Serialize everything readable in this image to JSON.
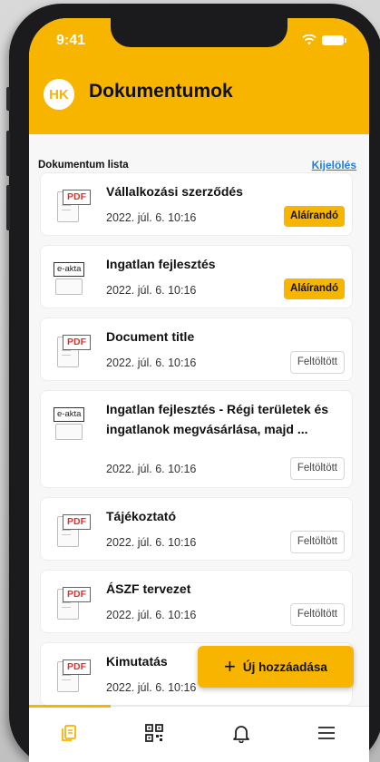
{
  "status_bar": {
    "time": "9:41"
  },
  "header": {
    "avatar_initials": "HK",
    "title": "Dokumentumok"
  },
  "list": {
    "title": "Dokumentum lista",
    "select_link": "Kijelölés"
  },
  "documents": [
    {
      "type": "PDF",
      "title": "Vállalkozási szerződés",
      "date": "2022. júl. 6. 10:16",
      "status": "Aláírandó"
    },
    {
      "type": "e-akta",
      "title": "Ingatlan fejlesztés",
      "date": "2022. júl. 6. 10:16",
      "status": "Aláírandó"
    },
    {
      "type": "PDF",
      "title": "Document title",
      "date": "2022. júl. 6. 10:16",
      "status": "Feltöltött"
    },
    {
      "type": "e-akta",
      "title": "Ingatlan fejlesztés - Régi területek és ingatlanok megvásárlása, majd ...",
      "date": "2022. júl. 6. 10:16",
      "status": "Feltöltött"
    },
    {
      "type": "PDF",
      "title": "Tájékoztató",
      "date": "2022. júl. 6. 10:16",
      "status": "Feltöltött"
    },
    {
      "type": "PDF",
      "title": "ÁSZF tervezet",
      "date": "2022. júl. 6. 10:16",
      "status": "Feltöltött"
    },
    {
      "type": "PDF",
      "title": "Kimutatás",
      "date": "2022. júl. 6. 10:16",
      "status": ""
    }
  ],
  "fab": {
    "icon": "+",
    "label": "Új hozzáadása"
  },
  "tabbar": {
    "active": "documents",
    "icons": [
      "documents-icon",
      "qr-code-icon",
      "bell-icon",
      "menu-icon"
    ]
  },
  "colors": {
    "accent": "#f7b500",
    "link": "#1c7ed6",
    "pdf_red": "#d9342b"
  }
}
